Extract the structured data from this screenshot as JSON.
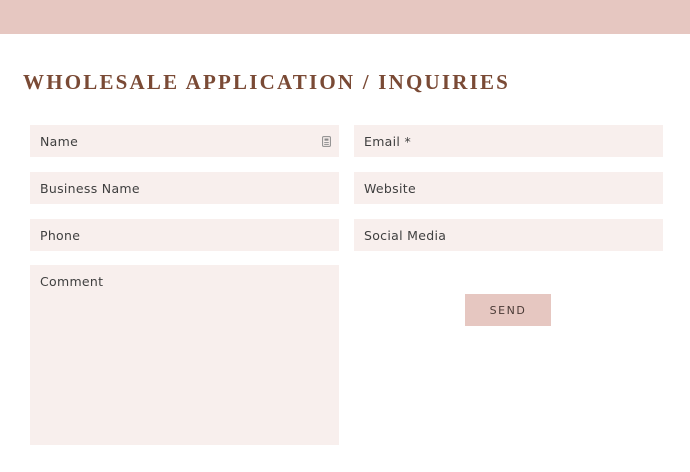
{
  "header": {
    "title": "WHOLESALE APPLICATION / INQUIRIES"
  },
  "form": {
    "name_placeholder": "Name",
    "email_placeholder": "Email *",
    "business_name_placeholder": "Business Name",
    "website_placeholder": "Website",
    "phone_placeholder": "Phone",
    "social_media_placeholder": "Social Media",
    "comment_placeholder": "Comment",
    "send_label": "SEND"
  },
  "colors": {
    "band": "#e6c7c1",
    "field_bg": "#f8efed",
    "title": "#7a4a35",
    "button": "#e6c7c1"
  },
  "icons": {
    "name_field_icon": "contact-card-icon"
  }
}
